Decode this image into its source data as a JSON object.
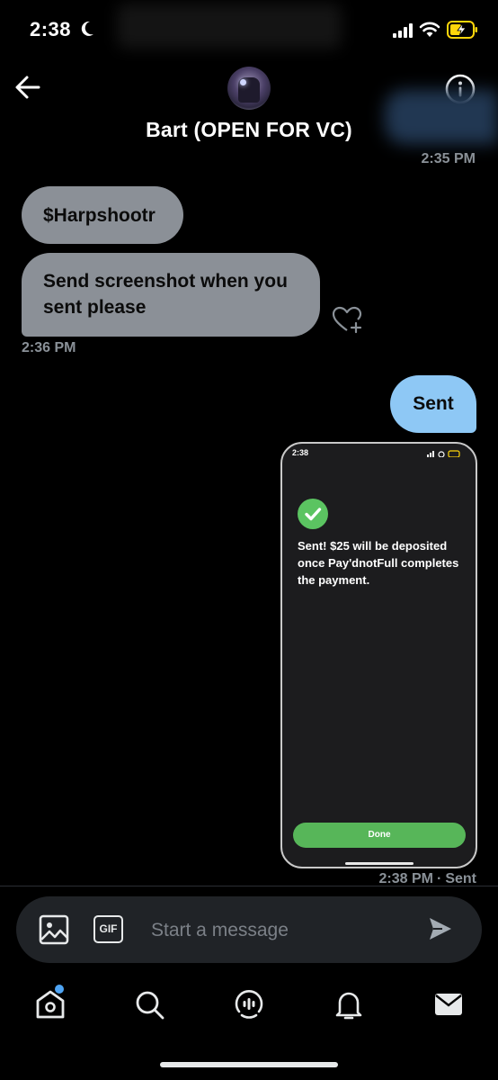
{
  "status_bar": {
    "time": "2:38"
  },
  "header": {
    "contact_name": "Bart (OPEN FOR VC)"
  },
  "thread": {
    "timestamp_1": "2:35 PM",
    "messages_in": [
      {
        "text": "$Harpshootr"
      },
      {
        "text": "Send screenshot when you sent please"
      }
    ],
    "timestamp_2": "2:36 PM",
    "message_out": {
      "text": "Sent"
    },
    "attachment": {
      "time": "2:38",
      "message": "Sent! $25 will be deposited once Pay'dnotFull completes the payment.",
      "button_label": "Done"
    },
    "last_timestamp": "2:38 PM",
    "delivery_status": "Sent"
  },
  "composer": {
    "placeholder": "Start a message",
    "gif_label": "GIF"
  },
  "nav": {
    "items": [
      {
        "icon": "home-icon"
      },
      {
        "icon": "search-icon"
      },
      {
        "icon": "spaces-icon"
      },
      {
        "icon": "notifications-icon"
      },
      {
        "icon": "messages-icon"
      }
    ]
  },
  "colors": {
    "incoming_bubble": "#8b9097",
    "outgoing_bubble": "#8ec8f5",
    "accent": "#4ea4f4",
    "success": "#5bc461"
  }
}
